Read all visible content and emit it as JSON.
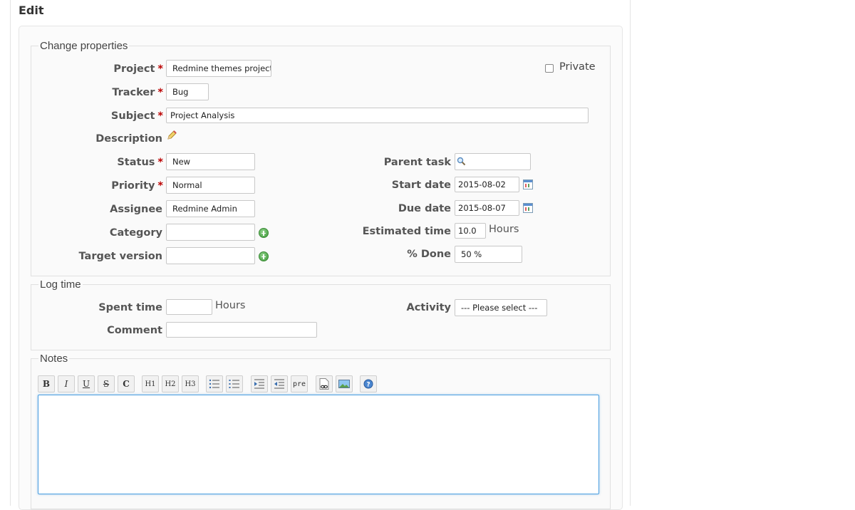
{
  "page": {
    "title": "Edit"
  },
  "properties": {
    "legend": "Change properties",
    "private_label": "Private",
    "project": {
      "label": "Project",
      "value": "Redmine themes project"
    },
    "tracker": {
      "label": "Tracker",
      "value": "Bug"
    },
    "subject": {
      "label": "Subject",
      "value": "Project Analysis"
    },
    "description": {
      "label": "Description"
    },
    "status": {
      "label": "Status",
      "value": "New"
    },
    "priority": {
      "label": "Priority",
      "value": "Normal"
    },
    "assignee": {
      "label": "Assignee",
      "value": "Redmine Admin"
    },
    "category": {
      "label": "Category",
      "value": ""
    },
    "target_version": {
      "label": "Target version",
      "value": ""
    },
    "parent_task": {
      "label": "Parent task",
      "value": ""
    },
    "start_date": {
      "label": "Start date",
      "value": "2015-08-02"
    },
    "due_date": {
      "label": "Due date",
      "value": "2015-08-07"
    },
    "estimated_time": {
      "label": "Estimated time",
      "value": "10.0",
      "unit": "Hours"
    },
    "done": {
      "label": "% Done",
      "value": "50 %"
    },
    "required_mark": "*"
  },
  "log_time": {
    "legend": "Log time",
    "spent_time": {
      "label": "Spent time",
      "value": "",
      "unit": "Hours"
    },
    "activity": {
      "label": "Activity",
      "value": "--- Please select ---"
    },
    "comment": {
      "label": "Comment",
      "value": ""
    }
  },
  "notes": {
    "legend": "Notes",
    "toolbar": [
      "B",
      "I",
      "U",
      "S",
      "C",
      "H1",
      "H2",
      "H3",
      "pre"
    ]
  }
}
